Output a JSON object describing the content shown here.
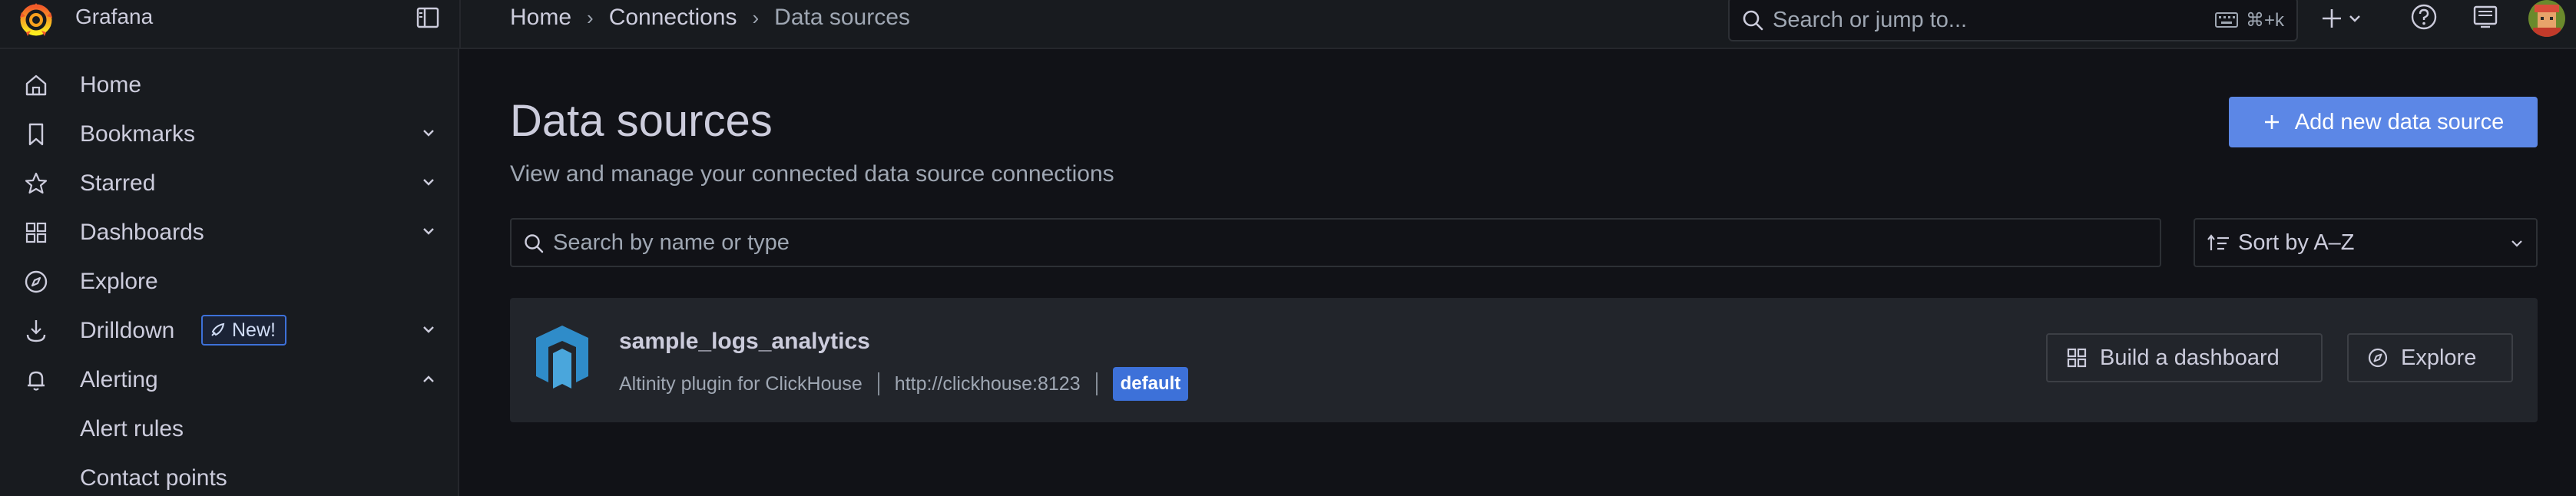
{
  "app": {
    "name": "Grafana"
  },
  "breadcrumb": [
    {
      "label": "Home"
    },
    {
      "label": "Connections"
    },
    {
      "label": "Data sources"
    }
  ],
  "topbar": {
    "search_placeholder": "Search or jump to...",
    "search_shortcut": "⌘+k"
  },
  "sidebar": {
    "items": [
      {
        "label": "Home",
        "icon": "home-icon"
      },
      {
        "label": "Bookmarks",
        "icon": "bookmark-icon",
        "expandable": true
      },
      {
        "label": "Starred",
        "icon": "star-icon",
        "expandable": true
      },
      {
        "label": "Dashboards",
        "icon": "apps-icon",
        "expandable": true
      },
      {
        "label": "Explore",
        "icon": "compass-icon"
      },
      {
        "label": "Drilldown",
        "icon": "drilldown-icon",
        "expandable": true,
        "badge": "New!"
      },
      {
        "label": "Alerting",
        "icon": "bell-icon",
        "expanded": true
      },
      {
        "label": "Alert rules",
        "child": true
      },
      {
        "label": "Contact points",
        "child": true
      }
    ]
  },
  "page": {
    "title": "Data sources",
    "subtitle": "View and manage your connected data source connections",
    "add_button": "Add new data source",
    "filter_placeholder": "Search by name or type",
    "sort_value": "Sort by A–Z"
  },
  "datasources": [
    {
      "name": "sample_logs_analytics",
      "plugin": "Altinity plugin for ClickHouse",
      "url": "http://clickhouse:8123",
      "badge": "default",
      "build_button": "Build a dashboard",
      "explore_button": "Explore"
    }
  ],
  "colors": {
    "primary": "#5c87e6",
    "badge_default": "#3d71d9",
    "background": "#111217",
    "panel": "#181b1f",
    "card": "#22252b",
    "logo_orange": "#f46800"
  }
}
